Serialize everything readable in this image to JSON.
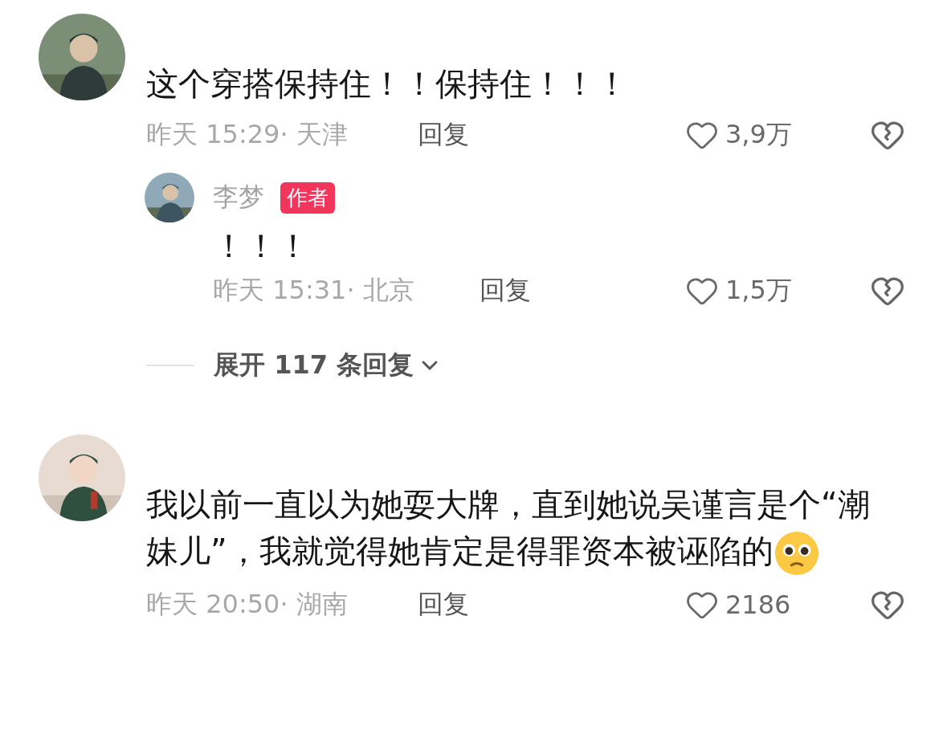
{
  "comments": [
    {
      "avatar": {
        "kind": "picture"
      },
      "text": "这个穿搭保持住！！保持住！！！",
      "emoji": false,
      "time": "昨天 15:29·",
      "location": "天津",
      "reply_label": "回复",
      "likes": "3,9万",
      "replies": [
        {
          "name": "李梦",
          "badge": "作者",
          "avatar": {
            "kind": "picture"
          },
          "text": "！！！",
          "time": "昨天 15:31·",
          "location": "北京",
          "reply_label": "回复",
          "likes": "1,5万"
        }
      ],
      "expand": "展开 117 条回复"
    },
    {
      "avatar": {
        "kind": "picture"
      },
      "text": "我以前一直以为她耍大牌，直到她说吴谨言是个“潮妹儿”，我就觉得她肯定是得罪资本被诬陷的",
      "emoji": true,
      "time": "昨天 20:50·",
      "location": "湖南",
      "reply_label": "回复",
      "likes": "2186"
    }
  ]
}
